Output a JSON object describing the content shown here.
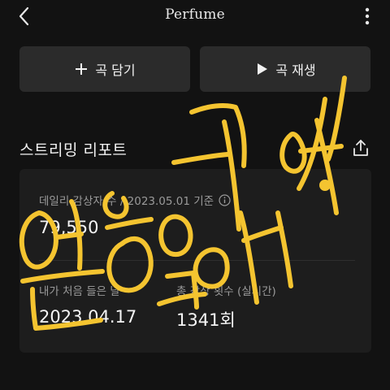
{
  "header": {
    "title": "Perfume",
    "back_icon": "chevron-left-icon",
    "more_icon": "more-vertical-icon"
  },
  "actions": {
    "add_label": "곡 담기",
    "add_icon": "plus-icon",
    "play_label": "곡 재생",
    "play_icon": "play-icon"
  },
  "report": {
    "title": "스트리밍 리포트",
    "share_icon": "share-icon",
    "daily_label": "데일리 감상자 수 / 2023.05.01 기준",
    "daily_value": "79,550",
    "first_listen_label": "내가 처음 들은 날",
    "first_listen_value": "2023.04.17",
    "total_plays_label": "총 감상 횟수 (실시간)",
    "total_plays_value": "1341회"
  },
  "colors": {
    "background": "#121212",
    "button": "#2b2b2b",
    "card": "#1d1d1d",
    "handwriting": "#f4c430"
  }
}
